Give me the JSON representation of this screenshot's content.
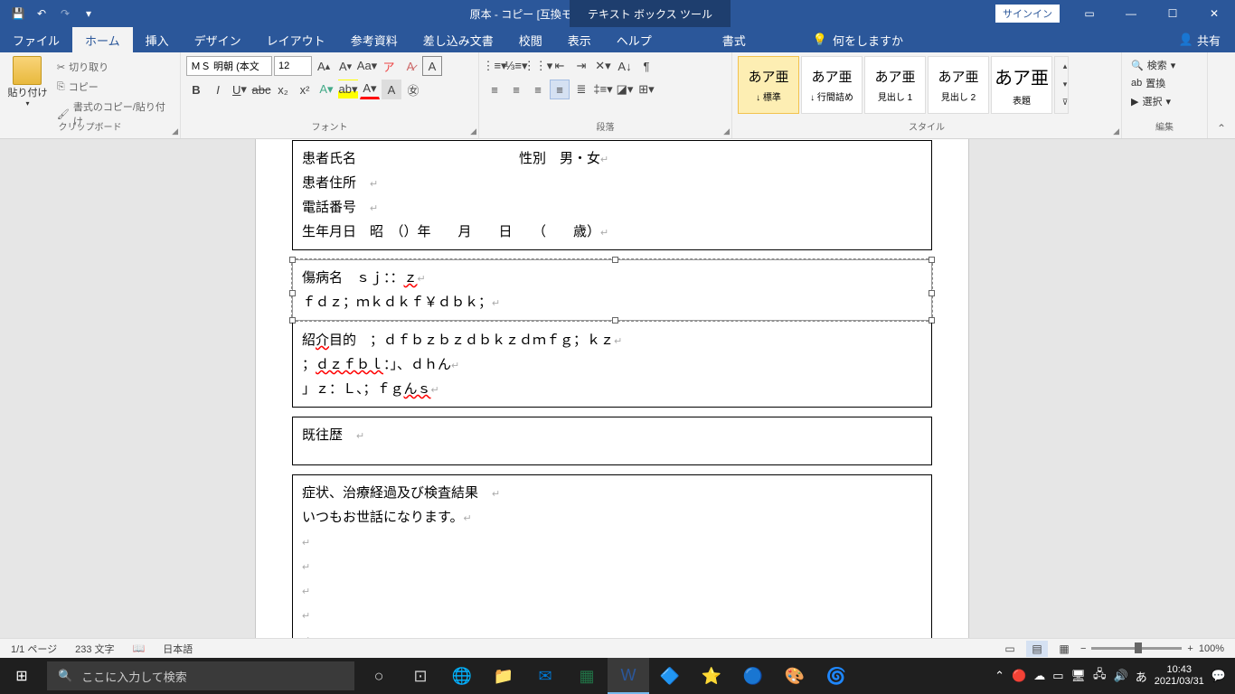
{
  "title": "原本 - コピー [互換モード] - Word",
  "context_tab": "テキスト ボックス ツール",
  "sign_in": "サインイン",
  "tabs": {
    "file": "ファイル",
    "home": "ホーム",
    "insert": "挿入",
    "design": "デザイン",
    "layout": "レイアウト",
    "references": "参考資料",
    "mailings": "差し込み文書",
    "review": "校閲",
    "view": "表示",
    "help": "ヘルプ",
    "format": "書式",
    "tellme": "何をしますか",
    "share": "共有"
  },
  "ribbon": {
    "clipboard": {
      "paste": "貼り付け",
      "cut": "切り取り",
      "copy": "コピー",
      "format_painter": "書式のコピー/貼り付け",
      "label": "クリップボード"
    },
    "font": {
      "name": "ＭＳ 明朝 (本文",
      "size": "12",
      "label": "フォント"
    },
    "paragraph": {
      "label": "段落"
    },
    "styles": {
      "label": "スタイル",
      "items": [
        {
          "preview": "あア亜",
          "name": "↓ 標準"
        },
        {
          "preview": "あア亜",
          "name": "↓ 行間詰め"
        },
        {
          "preview": "あア亜",
          "name": "見出し 1"
        },
        {
          "preview": "あア亜",
          "name": "見出し 2"
        },
        {
          "preview": "あア亜",
          "name": "表題"
        }
      ]
    },
    "editing": {
      "find": "検索",
      "replace": "置換",
      "select": "選択",
      "label": "編集"
    }
  },
  "doc": {
    "box1": {
      "l1a": "患者氏名",
      "l1b": "性別　男・女",
      "l2": "患者住所",
      "l3": "電話番号",
      "l4": "生年月日　昭　（）年　　月　　日　　（　　歳）"
    },
    "box2": {
      "l1a": "傷病名　ｓｊ：：",
      "l1b": "ｚ",
      "l2": "ｆｄｚ；ｍｋｄｋｆ￥ｄｂｋ；"
    },
    "box3": {
      "l1a": "紹",
      "l1b": "介",
      "l1c": "目",
      "l1d": "的　；ｄｆｂｚｂｚｄｂｋｚｄｍｆｇ；ｋｚ",
      "l2a": "；",
      "l2b": "ｄｚｆｂｌ",
      "l2c": "：」、ｄｈん",
      "l3a": "」ｚ：Ｌ、；ｆｇ",
      "l3b": "んｓ"
    },
    "box4": {
      "l1": "既往歴"
    },
    "box5": {
      "l1": "症状、治療経過及び検査結果",
      "l2": "いつもお世話になります。"
    }
  },
  "status": {
    "page": "1/1 ページ",
    "words": "233 文字",
    "lang": "日本語",
    "zoom": "100%"
  },
  "taskbar": {
    "search_placeholder": "ここに入力して検索",
    "time": "10:43",
    "date": "2021/03/31",
    "ime": "あ"
  }
}
